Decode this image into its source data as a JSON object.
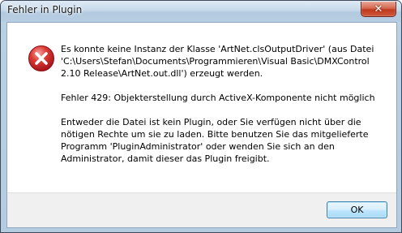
{
  "window": {
    "title": "Fehler in Plugin",
    "close_glyph": "✕"
  },
  "dialog": {
    "icon": "error-icon",
    "message_lines": [
      "Es konnte keine Instanz der Klasse 'ArtNet.clsOutputDriver' (aus Datei",
      "'C:\\Users\\Stefan\\Documents\\Programmieren\\Visual Basic\\DMXControl",
      "2.10 Release\\ArtNet.out.dll') erzeugt werden."
    ],
    "error_line": "Fehler 429: Objekterstellung durch ActiveX-Komponente nicht möglich",
    "hint_lines": [
      "Entweder die Datei ist kein Plugin, oder Sie verfügen nicht über die",
      "nötigen Rechte um sie zu laden. Bitte benutzen Sie das mitgelieferte",
      "Programm 'PluginAdministrator' oder wenden Sie sich an den",
      "Administrator, damit dieser das Plugin freigibt."
    ]
  },
  "buttons": {
    "ok_label": "OK"
  },
  "colors": {
    "error_red": "#d2232a",
    "button_border": "#3c7fb1"
  }
}
